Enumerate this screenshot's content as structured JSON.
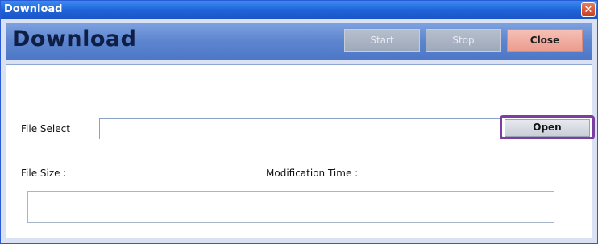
{
  "window": {
    "title": "Download",
    "close_glyph": "✕"
  },
  "header": {
    "title": "Download",
    "start_label": "Start",
    "stop_label": "Stop",
    "close_label": "Close"
  },
  "form": {
    "file_select_label": "File Select",
    "file_select_value": "",
    "open_label": "Open",
    "file_size_label": "File Size :",
    "modification_time_label": "Modification Time :"
  },
  "colors": {
    "accent_highlight": "#7b3fa0",
    "close_button": "#ec9c8e",
    "header_bg": "#5d85cf"
  }
}
